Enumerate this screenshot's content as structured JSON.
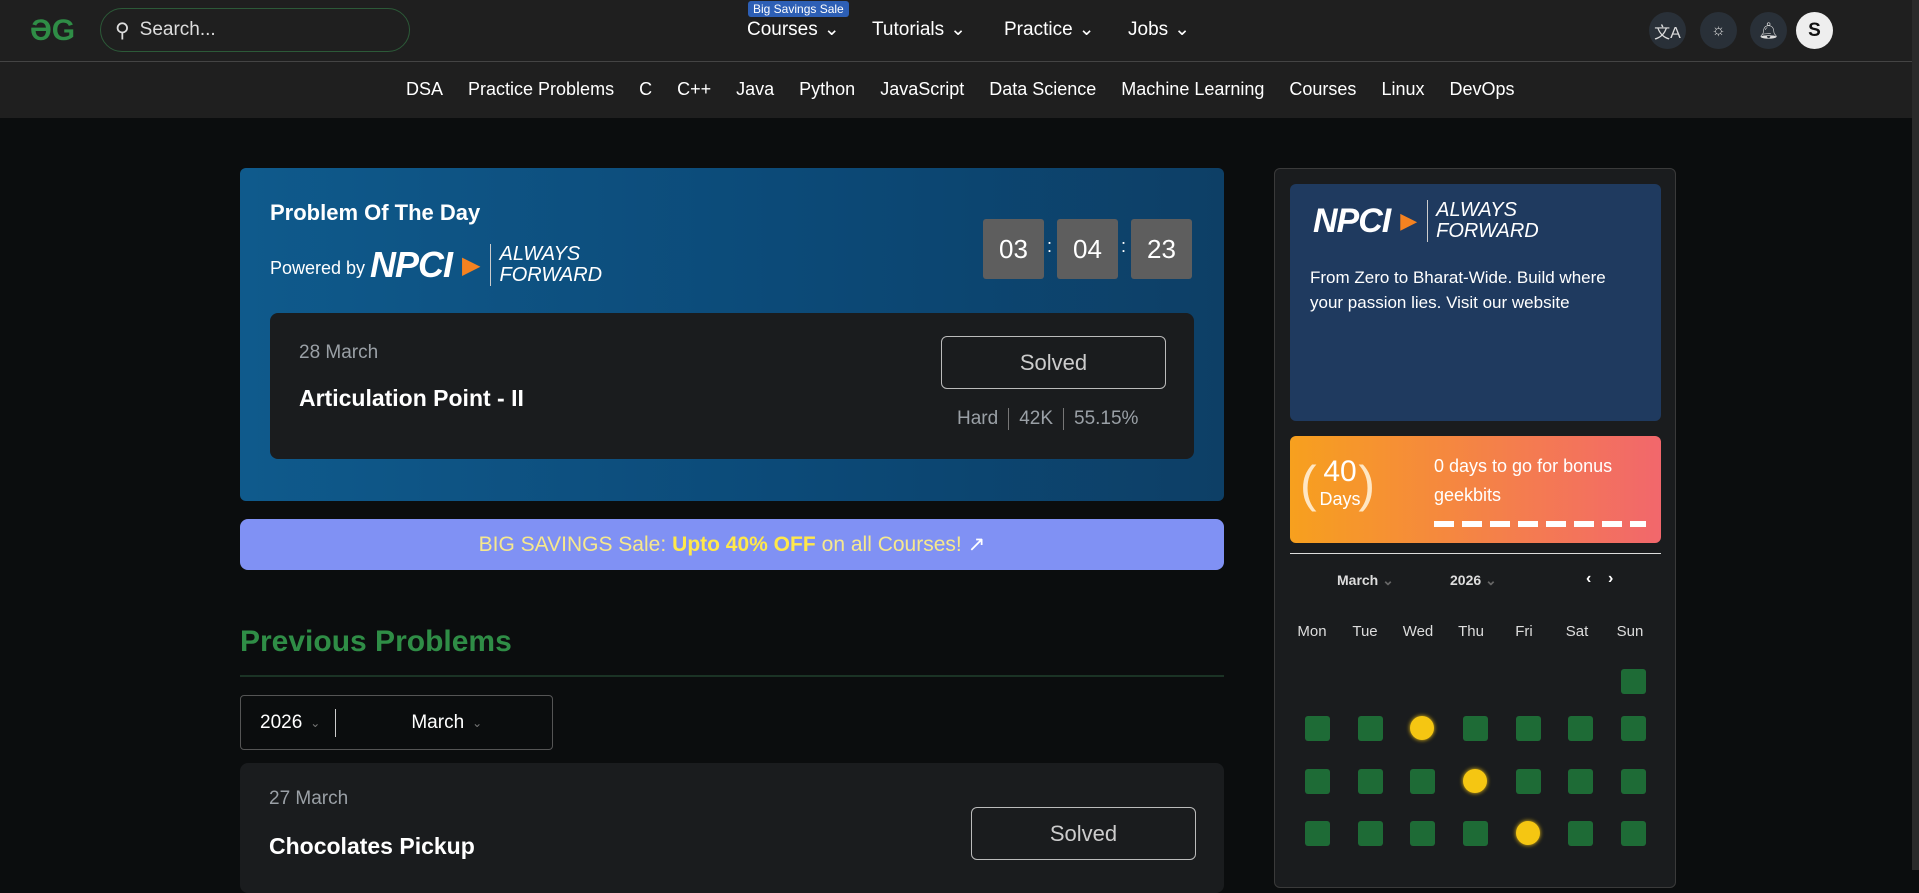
{
  "header": {
    "search_placeholder": "Search...",
    "sale_badge": "Big Savings Sale",
    "nav": [
      "Courses",
      "Tutorials",
      "Practice",
      "Jobs"
    ],
    "avatar": "S"
  },
  "subnav": [
    "DSA",
    "Practice Problems",
    "C",
    "C++",
    "Java",
    "Python",
    "JavaScript",
    "Data Science",
    "Machine Learning",
    "Courses",
    "Linux",
    "DevOps"
  ],
  "potd": {
    "title": "Problem Of The Day",
    "powered_by": "Powered by",
    "sponsor_logo": "NPCI",
    "sponsor_tagline_1": "ALWAYS",
    "sponsor_tagline_2": "FORWARD",
    "timer": [
      "03",
      "04",
      "23"
    ],
    "date": "28 March",
    "problem": "Articulation Point - II",
    "status": "Solved",
    "difficulty": "Hard",
    "submissions": "42K",
    "accuracy": "55.15%"
  },
  "sale": {
    "prefix": "BIG SAVINGS Sale:",
    "bold": "Upto 40% OFF",
    "suffix": "on all Courses!"
  },
  "previous": {
    "heading": "Previous Problems",
    "year": "2026",
    "month": "March",
    "items": [
      {
        "date": "27 March",
        "title": "Chocolates Pickup",
        "status": "Solved"
      }
    ]
  },
  "sidebar": {
    "ad_logo": "NPCI",
    "ad_tagline_1": "ALWAYS",
    "ad_tagline_2": "FORWARD",
    "ad_text": "From Zero to Bharat-Wide. Build where your passion lies. Visit our website",
    "streak_number": "40",
    "streak_unit": "Days",
    "streak_text": "0 days to go for bonus geekbits",
    "cal_month": "March",
    "cal_year": "2026",
    "weekdays": [
      "Mon",
      "Tue",
      "Wed",
      "Thu",
      "Fri",
      "Sat",
      "Sun"
    ]
  },
  "colors": {
    "brand": "#2f8d46",
    "solved_cell": "#1e6b36",
    "coin": "#f5c612"
  }
}
